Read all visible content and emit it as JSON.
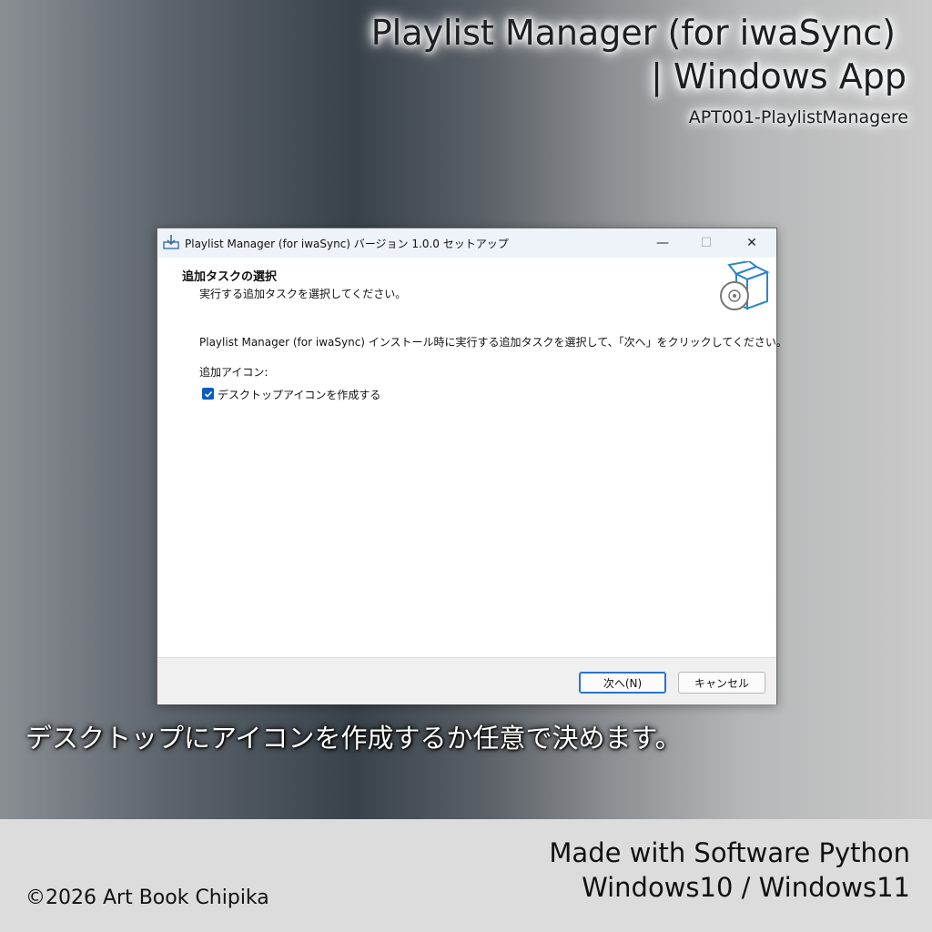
{
  "banner": {
    "title_line1": "Playlist Manager (for iwaSync)",
    "title_line2": "| Windows App",
    "code": "APT001-PlaylistManagere"
  },
  "dialog": {
    "window_title": "Playlist Manager (for iwaSync) バージョン 1.0.0 セットアップ",
    "section_title": "追加タスクの選択",
    "section_subtitle": "実行する追加タスクを選択してください。",
    "body_text": "Playlist Manager (for iwaSync) インストール時に実行する追加タスクを選択して、「次へ」をクリックしてください。",
    "icons_group_label": "追加アイコン:",
    "checkbox_label": "デスクトップアイコンを作成する",
    "checkbox_checked": true,
    "next_button": "次へ(N)",
    "cancel_button": "キャンセル",
    "title_minimize": "—",
    "title_maximize": "☐",
    "title_close": "✕",
    "accent_color": "#0b5cc1"
  },
  "caption": "デスクトップにアイコンを作成するか任意で決めます。",
  "footer": {
    "made_with": "Made with Software Python",
    "platforms": "Windows10 / Windows11",
    "copyright": "©2026 Art Book Chipika"
  },
  "icons": {
    "titlebar": "installer-download-icon",
    "header": "package-disc-icon",
    "checkbox": "checkmark-icon"
  }
}
